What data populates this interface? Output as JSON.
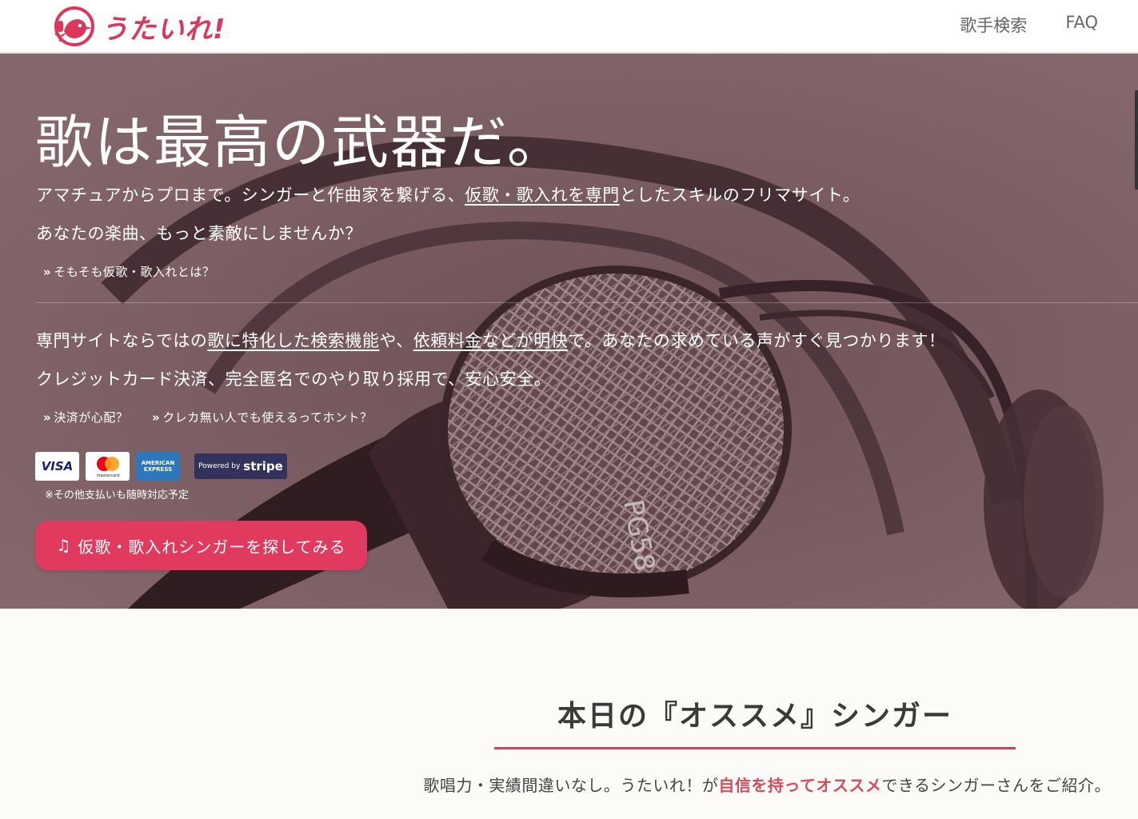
{
  "header": {
    "logo_text": "うたいれ!",
    "nav": [
      {
        "label": "歌手検索"
      },
      {
        "label": "FAQ"
      }
    ]
  },
  "hero": {
    "title": "歌は最高の武器だ。",
    "line1_a": "アマチュアからプロまで。シンガーと作曲家を繋げる、",
    "line1_link": "仮歌・歌入れを専門",
    "line1_b": "としたスキルのフリマサイト。",
    "line2": "あなたの楽曲、もっと素敵にしませんか？",
    "link_what": "そもそも仮歌・歌入れとは？",
    "line3_a": "専門サイトならではの",
    "line3_link1": "歌に特化した検索機能",
    "line3_b": "や、",
    "line3_link2": "依頼料金などが明快",
    "line3_c": "で。あなたの求めている声がすぐ見つかります！",
    "line4": "クレジットカード決済、完全匿名でのやり取り採用で、安心安全。",
    "link_payment": "決済が心配？",
    "link_nocard": "クレカ無い人でも使えるってホント？",
    "cards": {
      "visa": "VISA",
      "mastercard": "mastercard",
      "amex_top": "AMERICAN",
      "amex_bottom": "EXPRESS",
      "stripe_prefix": "Powered by",
      "stripe_brand": "stripe"
    },
    "cards_note": "※その他支払いも随時対応予定",
    "cta_label": "仮歌・歌入れシンガーを探してみる",
    "chevron_glyph": "»"
  },
  "recommend": {
    "title": "本日の『オススメ』シンガー",
    "sub_a": "歌唱力・実績間違いなし。うたいれ！が",
    "sub_em": "自信を持ってオススメ",
    "sub_b": "できるシンガーさんをご紹介。"
  },
  "colors": {
    "brand": "#d9385b",
    "hero_tint": "#8e6f74",
    "cta": "#e03a5e",
    "rule": "#c94762"
  }
}
